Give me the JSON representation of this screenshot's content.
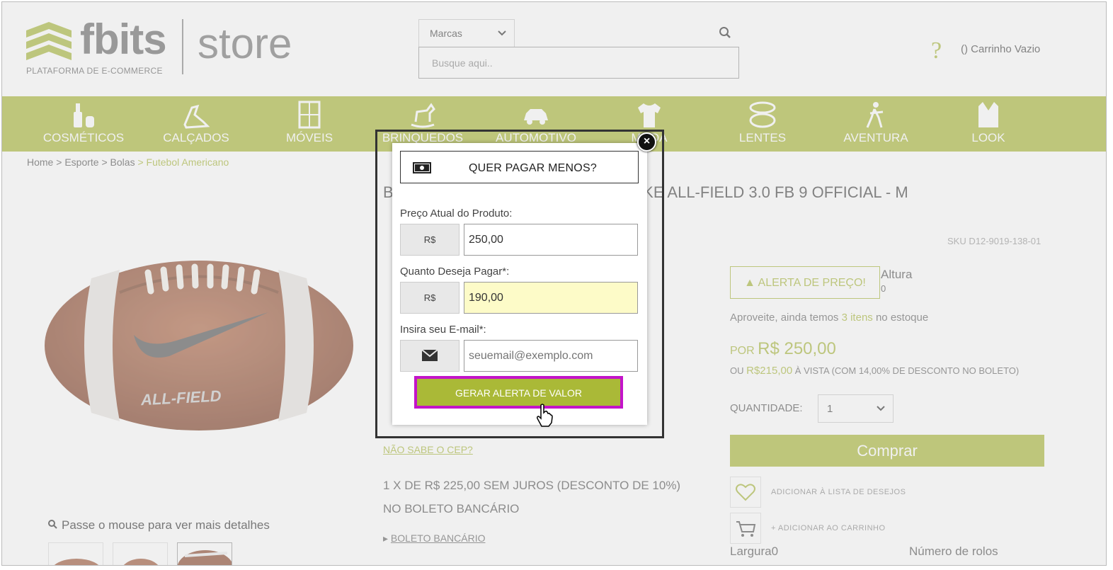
{
  "header": {
    "logo_text": "fbits",
    "logo_subtitle": "PLATAFORMA DE E-COMMERCE",
    "logo_store": "store",
    "brand_select_value": "Marcas",
    "search_placeholder": "Busque aqui..",
    "help_icon": "?",
    "cart_text": "() Carrinho Vazio"
  },
  "nav": {
    "items": [
      {
        "label": "Cosméticos",
        "icon": "cosmetics-icon"
      },
      {
        "label": "Calçados",
        "icon": "shoes-icon"
      },
      {
        "label": "Móveis",
        "icon": "furniture-icon"
      },
      {
        "label": "Brinquedos",
        "icon": "toys-icon"
      },
      {
        "label": "Automotivo",
        "icon": "car-icon"
      },
      {
        "label": "Moda",
        "icon": "shirt-icon"
      },
      {
        "label": "Lentes",
        "icon": "lenses-icon"
      },
      {
        "label": "Aventura",
        "icon": "adventure-icon"
      },
      {
        "label": "Look",
        "icon": "jacket-icon"
      }
    ]
  },
  "breadcrumb": {
    "home": "Home",
    "sep": " > ",
    "l1": "Esporte",
    "l2": "Bolas",
    "current": "Futebol Americano"
  },
  "product": {
    "title": "BOLA DE FUTEBOL AMERICANO NIKE ALL-FIELD 3.0 FB 9 OFFICIAL - M",
    "sku": "SKU D12-9019-138-01",
    "alert_button": "ALERTA DE PREÇO!",
    "altura_label": "Altura",
    "altura_value": "0",
    "stock_prefix": "Aproveite, ainda temos ",
    "stock_count": "3 itens",
    "stock_suffix": " no estoque",
    "price_por": "POR ",
    "price_value": "R$ 250,00",
    "boleto_prefix": "OU ",
    "boleto_value": "R$215,00",
    "boleto_suffix": " À VISTA (COM 14,00% DE DESCONTO NO BOLETO)",
    "qty_label": "QUANTIDADE:",
    "qty_value": "1",
    "buy_button": "Comprar",
    "wishlist": "ADICIONAR À LISTA DE DESEJOS",
    "add_cart": "+ ADICIONAR AO CARRINHO",
    "largura": "Largura0",
    "rolos": "Número de rolos",
    "cep_link": "NÃO SABE O CEP?",
    "installment_line1": "1 X DE R$ 225,00 SEM JUROS (DESCONTO DE 10%)",
    "installment_line2": "NO BOLETO BANCÁRIO",
    "boleto_link": "BOLETO BANCÁRIO",
    "zoom_hint": "Passe o mouse para ver mais detalhes",
    "ball_text": "ALL-FIELD"
  },
  "modal": {
    "title": "QUER PAGAR MENOS?",
    "current_price_label": "Preço Atual do Produto:",
    "currency": "R$",
    "current_price_value": "250,00",
    "desired_label": "Quanto Deseja Pagar*:",
    "desired_value": "190,00",
    "email_label": "Insira seu E-mail*:",
    "email_placeholder": "seuemail@exemplo.com",
    "submit": "GERAR ALERTA DE VALOR",
    "close": "×"
  },
  "colors": {
    "brand_green": "#aab937",
    "highlight_border": "#c314c9"
  }
}
